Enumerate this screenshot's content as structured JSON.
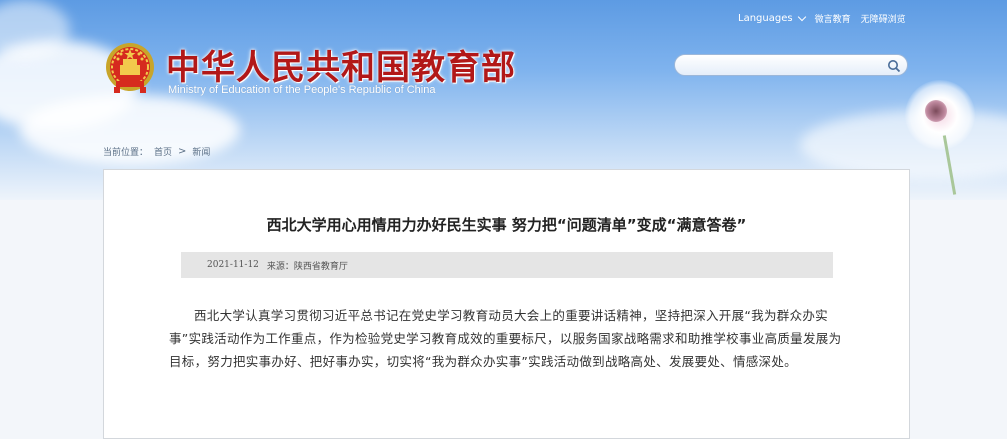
{
  "header": {
    "title_cn": "中华人民共和国教育部",
    "title_en": "Ministry of Education of the People's Republic of China",
    "links": {
      "languages": "Languages",
      "weiyan": "微言教育",
      "accessibility": "无障碍浏览"
    },
    "search": {
      "value": "",
      "icon": "search-icon"
    }
  },
  "breadcrumb": {
    "prefix": "当前位置：",
    "home": "首页",
    "separator": ">",
    "current": "新闻"
  },
  "article": {
    "title": "西北大学用心用情用力办好民生实事 努力把“问题清单”变成“满意答卷”",
    "date": "2021-11-12",
    "source": "来源：陕西省教育厅",
    "body": "西北大学认真学习贯彻习近平总书记在党史学习教育动员大会上的重要讲话精神，坚持把深入开展“我为群众办实事”实践活动作为工作重点，作为检验党史学习教育成效的重要标尺，以服务国家战略需求和助推学校事业高质量发展为目标，努力把实事办好、把好事办实，切实将“我为群众办实事”实践活动做到战略高处、发展要处、情感深处。"
  },
  "colors": {
    "title_red": "#b21818",
    "banner_blue": "#5d9be3",
    "meta_bg": "#e5e5e5"
  }
}
